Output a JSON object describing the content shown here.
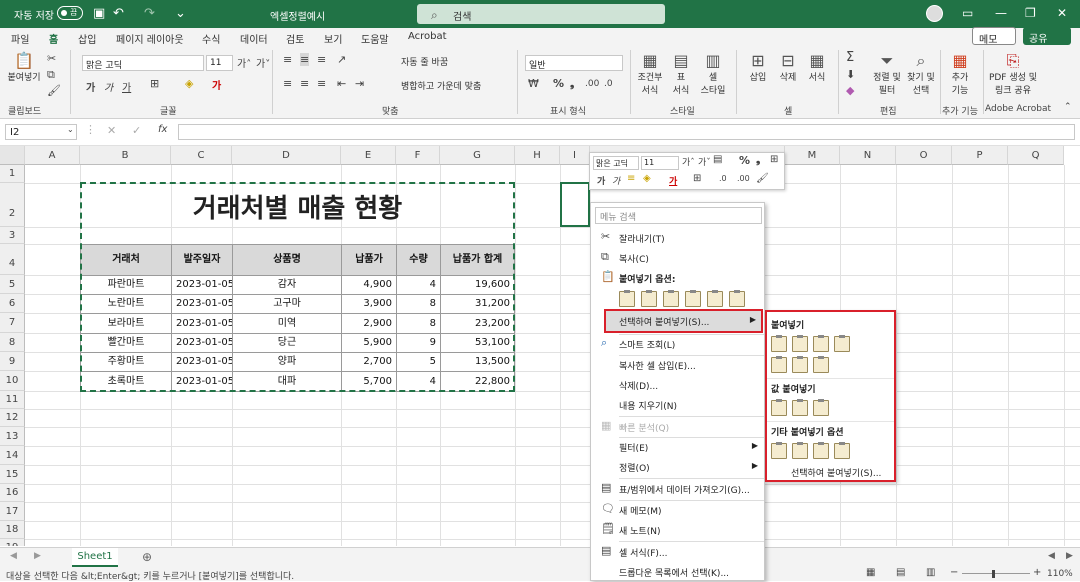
{
  "titlebar": {
    "autosave_label": "자동 저장",
    "autosave_state": "끔",
    "filename": "엑셀정렬예시",
    "search_placeholder": "검색"
  },
  "tabs": [
    "파일",
    "홈",
    "삽입",
    "페이지 레이아웃",
    "수식",
    "데이터",
    "검토",
    "보기",
    "도움말",
    "Acrobat"
  ],
  "active_tab": "홈",
  "memo_button": "메모",
  "share_button": "공유",
  "ribbon": {
    "paste": "붙여넣기",
    "font_name": "맑은 고딕",
    "font_size": "11",
    "wrap_text": "자동 줄 바꿈",
    "merge_center": "병합하고 가운데 맞춤",
    "number_format": "일반",
    "cond_format": [
      "조건부",
      "서식"
    ],
    "table_format": [
      "표",
      "서식"
    ],
    "cell_style": [
      "셀",
      "스타일"
    ],
    "insert": "삽입",
    "delete": "삭제",
    "format": "서식",
    "sort_filter": [
      "정렬 및",
      "필터"
    ],
    "find_select": [
      "찾기 및",
      "선택"
    ],
    "addins": [
      "추가",
      "기능"
    ],
    "pdf": [
      "PDF 생성 및",
      "링크 공유"
    ],
    "groups": [
      "클립보드",
      "글꼴",
      "맞춤",
      "표시 형식",
      "스타일",
      "셀",
      "편집",
      "추가 기능",
      "Adobe Acrobat"
    ]
  },
  "namebox": "I2",
  "fx_symbol": "fx",
  "columns": [
    "A",
    "B",
    "C",
    "D",
    "E",
    "F",
    "G",
    "H",
    "I",
    "",
    "",
    "M",
    "N",
    "O",
    "P",
    "Q"
  ],
  "rows": [
    "1",
    "2",
    "3",
    "4",
    "5",
    "6",
    "7",
    "8",
    "9",
    "10",
    "11",
    "12",
    "13",
    "14",
    "15",
    "16",
    "17",
    "18",
    "19"
  ],
  "sheet": {
    "title": "거래처별 매출 현황",
    "headers": [
      "거래처",
      "발주일자",
      "상품명",
      "납품가",
      "수량",
      "납품가 합계"
    ],
    "data": [
      [
        "파란마트",
        "2023-01-05",
        "감자",
        "4,900",
        "4",
        "19,600"
      ],
      [
        "노란마트",
        "2023-01-05",
        "고구마",
        "3,900",
        "8",
        "31,200"
      ],
      [
        "보라마트",
        "2023-01-05",
        "미역",
        "2,900",
        "8",
        "23,200"
      ],
      [
        "빨간마트",
        "2023-01-05",
        "당근",
        "5,900",
        "9",
        "53,100"
      ],
      [
        "주황마트",
        "2023-01-05",
        "양파",
        "2,700",
        "5",
        "13,500"
      ],
      [
        "초록마트",
        "2023-01-05",
        "대파",
        "5,700",
        "4",
        "22,800"
      ]
    ]
  },
  "mini_toolbar": {
    "font": "맑은 고딕",
    "size": "11"
  },
  "context_menu": {
    "search": "메뉴 검색",
    "cut": "잘라내기(T)",
    "copy": "복사(C)",
    "paste_options": "붙여넣기 옵션:",
    "paste_special": "선택하여 붙여넣기(S)...",
    "smart_lookup": "스마트 조회(L)",
    "insert_copied": "복사한 셀 삽입(E)...",
    "delete": "삭제(D)...",
    "clear": "내용 지우기(N)",
    "quick_analysis": "빠른 분석(Q)",
    "filter": "필터(E)",
    "sort": "정렬(O)",
    "get_data": "표/범위에서 데이터 가져오기(G)...",
    "new_comment": "새 메모(M)",
    "new_note": "새 노트(N)",
    "format_cells": "셀 서식(F)...",
    "pick_list": "드롭다운 목록에서 선택(K)..."
  },
  "submenu": {
    "paste": "붙여넣기",
    "paste_values": "값 붙여넣기",
    "other_options": "기타 붙여넣기 옵션",
    "paste_special": "선택하여 붙여넣기(S)..."
  },
  "sheet_tab": "Sheet1",
  "status_text": "대상을 선택한 다음 &lt;Enter&gt; 키를 누르거나 [붙여넣기]를 선택합니다.",
  "zoom": "110%",
  "colors": {
    "accent": "#217346",
    "highlight": "#d9202b"
  }
}
